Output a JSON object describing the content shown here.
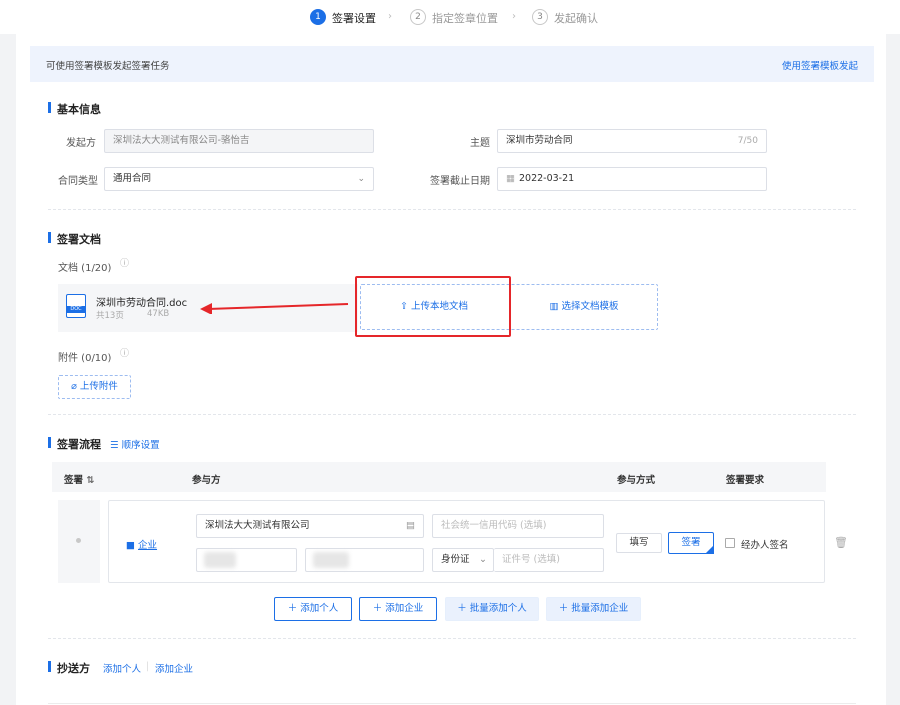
{
  "steps": [
    {
      "num": "1",
      "label": "签署设置",
      "active": true
    },
    {
      "num": "2",
      "label": "指定签章位置"
    },
    {
      "num": "3",
      "label": "发起确认"
    }
  ],
  "banner": {
    "text": "可使用签署模板发起签署任务",
    "link": "使用签署模板发起"
  },
  "basic": {
    "title": "基本信息",
    "initiator_label": "发起方",
    "initiator_value": "深圳法大大测试有限公司-骆怡吉",
    "subject_label": "主题",
    "subject_value": "深圳市劳动合同",
    "subject_count": "7/50",
    "type_label": "合同类型",
    "type_value": "通用合同",
    "deadline_label": "签署截止日期",
    "deadline_value": "2022-03-21"
  },
  "docs": {
    "title": "签署文档",
    "docs_label": "文档 (1/20)",
    "file_name": "深圳市劳动合同.doc",
    "file_pages": "共13页",
    "file_size": "47KB",
    "file_icon_text": "DOC",
    "upload_label": "上传本地文档",
    "template_label": "选择文档模板",
    "attach_label": "附件 (0/10)",
    "attach_button": "上传附件"
  },
  "flow": {
    "title": "签署流程",
    "order_link": "顺序设置",
    "headers": {
      "order": "签署",
      "party": "参与方",
      "mode": "参与方式",
      "req": "签署要求"
    },
    "row": {
      "type": "企业",
      "company": "深圳法大大测试有限公司",
      "credit_placeholder": "社会统一信用代码 (选填)",
      "id_type": "身份证",
      "id_placeholder": "证件号 (选填)",
      "mode_fill": "填写",
      "mode_sign": "签署",
      "agent_sign": "经办人签名"
    },
    "buttons": [
      "添加个人",
      "添加企业",
      "批量添加个人",
      "批量添加企业"
    ]
  },
  "cc": {
    "title": "抄送方",
    "add_person": "添加个人",
    "sep": "|",
    "add_company": "添加企业"
  },
  "colors": {
    "accent": "#1c6fe6",
    "annotation": "#e5262a"
  }
}
